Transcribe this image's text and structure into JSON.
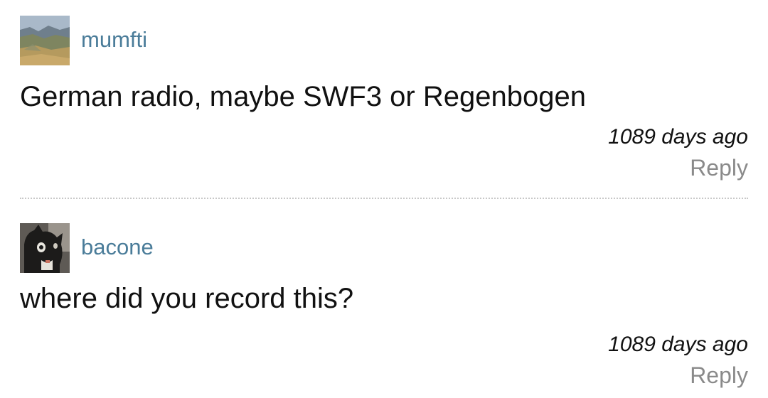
{
  "comments": [
    {
      "username": "mumfti",
      "avatar_icon": "landscape-avatar-icon",
      "text": "German radio, maybe SWF3 or Regenbogen",
      "timestamp": "1089 days ago",
      "reply_label": "Reply"
    },
    {
      "username": "bacone",
      "avatar_icon": "cat-avatar-icon",
      "text": "where did you record this?",
      "timestamp": "1089 days ago",
      "reply_label": "Reply"
    }
  ],
  "colors": {
    "username": "#4a7c99",
    "text": "#111111",
    "reply": "#8a8a8a",
    "divider": "#c8c8c8"
  }
}
